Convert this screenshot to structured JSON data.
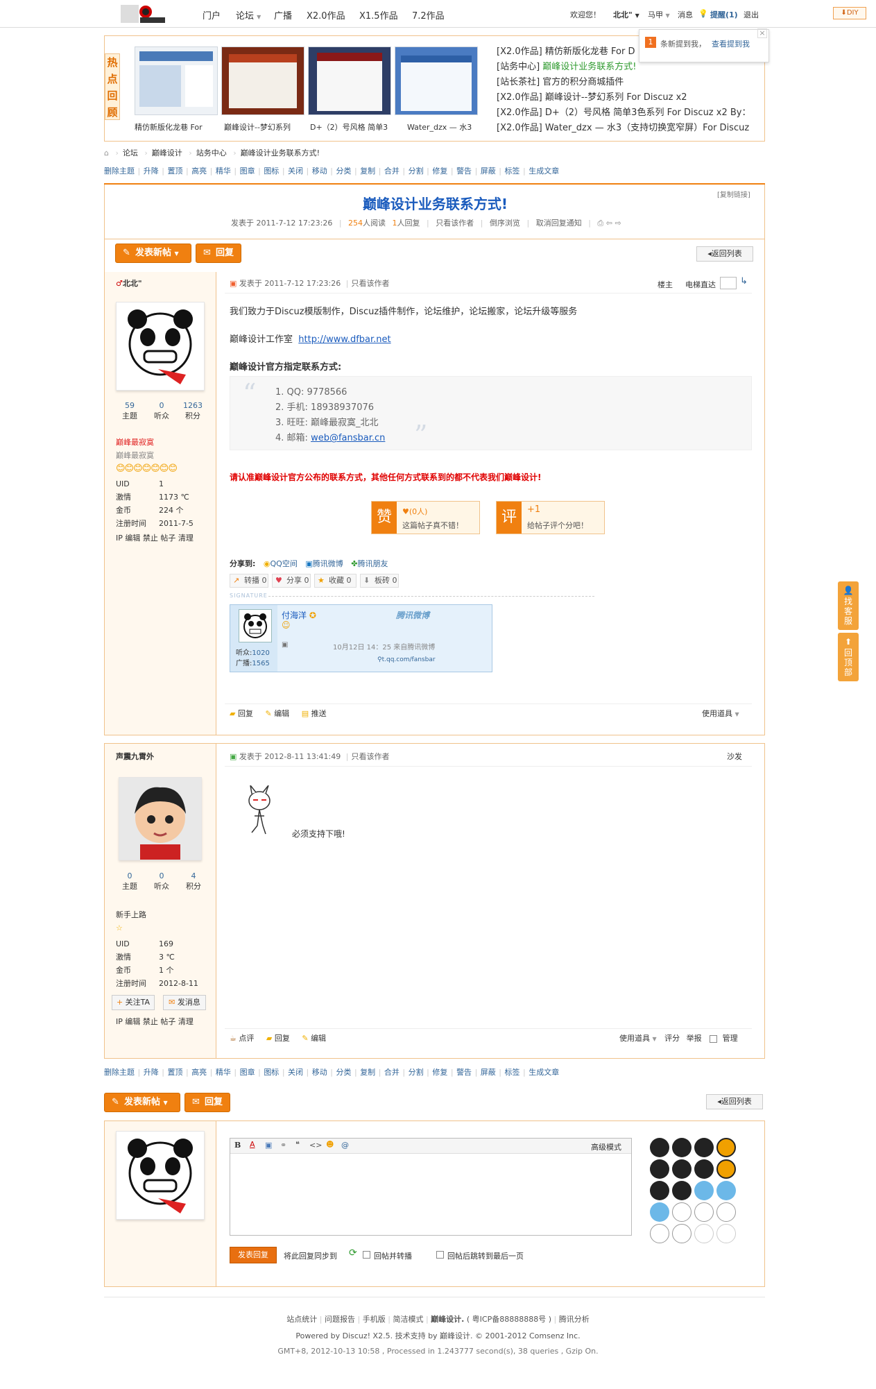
{
  "topbar": {
    "nav": [
      "门户",
      "论坛",
      "广播",
      "X2.0作品",
      "X1.5作品",
      "7.2作品"
    ],
    "welcome": "欢迎您！",
    "user": "北北\"",
    "user2": "马甲",
    "msg": "消息",
    "remind": "提醒(1)",
    "logout": "退出",
    "diy": "DIY"
  },
  "notice": {
    "count": "1",
    "text": "条新提到我，",
    "link": "查看提到我"
  },
  "hot": {
    "label": "热点回顾",
    "thumbs": [
      "精仿新版化龙巷 For",
      "巅峰设计--梦幻系列",
      "D+（2）号风格 简单3",
      "Water_dzx — 水3（"
    ],
    "list": [
      {
        "cat": "[X2.0作品]",
        "title": "精仿新版化龙巷 For D"
      },
      {
        "cat": "[站务中心]",
        "title": "巅峰设计业务联系方式!"
      },
      {
        "cat": "[站长茶社]",
        "title": "官方的积分商城插件"
      },
      {
        "cat": "[X2.0作品]",
        "title": "巅峰设计--梦幻系列 For Discuz x2"
      },
      {
        "cat": "[X2.0作品]",
        "title": "D+（2）号风格 简单3色系列 For Discuz x2 By："
      },
      {
        "cat": "[X2.0作品]",
        "title": "Water_dzx — 水3（支持切换宽窄屏）For Discuz"
      }
    ]
  },
  "breadcrumb": [
    "论坛",
    "巅峰设计",
    "站务中心",
    "巅峰设计业务联系方式!"
  ],
  "mod": [
    "删除主题",
    "升降",
    "置顶",
    "高亮",
    "精华",
    "图章",
    "图标",
    "关闭",
    "移动",
    "分类",
    "复制",
    "合并",
    "分割",
    "修复",
    "警告",
    "屏蔽",
    "标签",
    "生成文章"
  ],
  "thread": {
    "copylink": "[复制链接]",
    "title": "巅峰设计业务联系方式!",
    "posted": "发表于 2011-7-12 17:23:26",
    "views": "254",
    "views_lbl": "人阅读",
    "replies": "1",
    "replies_lbl": "人回复",
    "links": [
      "只看该作者",
      "倒序浏览",
      "取消回复通知"
    ]
  },
  "buttons": {
    "newpost": "发表新帖",
    "reply": "回复",
    "back": "返回列表"
  },
  "post1": {
    "author": "北北\"",
    "stats": [
      {
        "n": "59",
        "l": "主题"
      },
      {
        "n": "0",
        "l": "听众"
      },
      {
        "n": "1263",
        "l": "积分"
      }
    ],
    "group": "巅峰最寂寞",
    "group2": "巅峰最寂寞",
    "info": [
      [
        "UID",
        "1"
      ],
      [
        "激情",
        "1173 ℃"
      ],
      [
        "金币",
        "224 个"
      ],
      [
        "注册时间",
        "2011-7-5"
      ]
    ],
    "admin": "IP 编辑 禁止 帖子 清理",
    "meta": "发表于 2011-7-12 17:23:26",
    "onlyauthor": "只看该作者",
    "floor": "楼主",
    "jump": "电梯直达",
    "line1": "我们致力于Discuz模版制作，Discuz插件制作，论坛维护，论坛搬家，论坛升级等服务",
    "line2": "巅峰设计工作室",
    "url": "http://www.dfbar.net",
    "heading": "巅峰设计官方指定联系方式:",
    "contacts": [
      "1. QQ:   9778566",
      "2. 手机:  18938937076",
      "3. 旺旺:   巅峰最寂寞_北北",
      "4. 邮箱:  "
    ],
    "email": "web@fansbar.cn",
    "warning": "请认准巅峰设计官方公布的联系方式，其他任何方式联系到的都不代表我们巅峰设计!",
    "zan": "赞",
    "zan_count": "(0人)",
    "zan_text": "这篇帖子真不错！",
    "ping": "评",
    "ping_count": "+1",
    "ping_text": "给帖子评个分吧！",
    "share_lbl": "分享到:",
    "share": [
      "QQ空间",
      "腾讯微博",
      "腾讯朋友"
    ],
    "sbtns": [
      "转播 0",
      "分享 0",
      "收藏 0",
      "板砖 0"
    ],
    "sig": "SIGNATURE",
    "weibo": {
      "name": "付海洋",
      "brand": "腾讯微博",
      "fans": "听众:",
      "fans_n": "1020",
      "broadcast": "广播:",
      "broadcast_n": "1565",
      "time": "10月12日   14：25 来自腾讯微博",
      "url": "t.qq.com/fansbar"
    },
    "actions": [
      "回复",
      "编辑",
      "推送"
    ],
    "tools": "使用道具"
  },
  "post2": {
    "author": "声震九霄外",
    "stats": [
      {
        "n": "0",
        "l": "主题"
      },
      {
        "n": "0",
        "l": "听众"
      },
      {
        "n": "4",
        "l": "积分"
      }
    ],
    "group": "新手上路",
    "info": [
      [
        "UID",
        "169"
      ],
      [
        "激情",
        "3 ℃"
      ],
      [
        "金币",
        "1 个"
      ],
      [
        "注册时间",
        "2012-8-11"
      ]
    ],
    "follow": "关注TA",
    "message": "发消息",
    "admin": "IP 编辑 禁止 帖子 清理",
    "meta": "发表于 2012-8-11 13:41:49",
    "onlyauthor": "只看该作者",
    "floor": "沙发",
    "text": "必须支持下哦!",
    "actions": [
      "点评",
      "回复",
      "编辑"
    ],
    "tools": "使用道具",
    "rate": "评分",
    "report": "举报",
    "manage": "管理"
  },
  "editor": {
    "mode": "高级模式",
    "submit": "发表回复",
    "sync": "将此回复同步到",
    "opt1": "回帖并转播",
    "opt2": "回帖后跳转到最后一页"
  },
  "footer": {
    "links": [
      "站点统计",
      "问题报告",
      "手机版",
      "简洁模式"
    ],
    "brand": "巅峰设计.",
    "icp": "( 粤ICP备88888888号 )",
    "analysis": "腾讯分析",
    "powered": "Powered by Discuz! X2.5. 技术支持 by 巅峰设计. © 2001-2012 Comsenz Inc.",
    "gmt": "GMT+8, 2012-10-13 10:58 , Processed in 1.243777 second(s), 38 queries , Gzip On."
  },
  "float": {
    "service": "找客服",
    "top": "回顶部"
  }
}
